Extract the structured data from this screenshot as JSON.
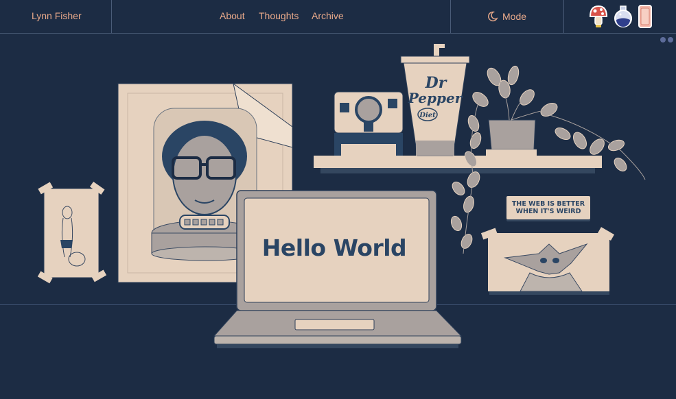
{
  "header": {
    "brand": "Lynn Fisher",
    "nav": [
      {
        "label": "About"
      },
      {
        "label": "Thoughts"
      },
      {
        "label": "Archive"
      }
    ],
    "mode_label": "Mode",
    "mode_icon": "moon-icon",
    "badges": [
      "mushroom-badge-icon",
      "potion-badge-icon",
      "pink-soda-badge-icon"
    ]
  },
  "scene": {
    "laptop_screen_text": "Hello World",
    "sign_line1": "THE WEB IS BETTER",
    "sign_line2": "WHEN IT'S WEIRD",
    "cup_brand_line1": "Dr",
    "cup_brand_line2": "Pepper",
    "cup_sub": "Diet"
  },
  "colors": {
    "background": "#1c2c44",
    "accent": "#e8a98a",
    "paper": "#e6d2bf",
    "ink": "#2a4564",
    "gray": "#a9a19e"
  }
}
